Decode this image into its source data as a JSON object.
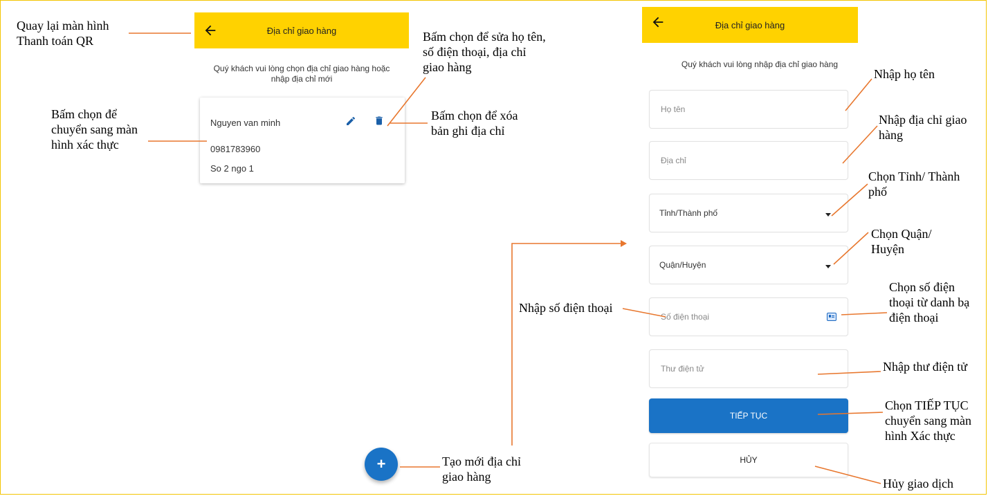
{
  "colors": {
    "header": "#ffd200",
    "primary": "#1a73c6",
    "annotation_line": "#e8772e"
  },
  "left_screen": {
    "header": {
      "title": "Địa chỉ giao hàng",
      "back_icon": "arrow-left-icon"
    },
    "subtitle": "Quý khách vui lòng chọn địa chỉ giao hàng hoặc\nnhập địa chỉ mới",
    "address_card": {
      "name": "Nguyen van minh",
      "phone": "0981783960",
      "address": "So 2 ngo 1",
      "edit_icon": "pencil-icon",
      "delete_icon": "trash-icon"
    },
    "fab": {
      "label": "+",
      "icon": "plus-icon"
    }
  },
  "right_screen": {
    "header": {
      "title": "Địa chỉ giao hàng",
      "back_icon": "arrow-left-icon"
    },
    "subtitle": "Quý khách vui lòng nhập địa chỉ giao hàng",
    "fields": {
      "name_placeholder": "Họ tên",
      "address_placeholder": "Địa chỉ",
      "province_label": "Tỉnh/Thành phố",
      "district_label": "Quận/Huyện",
      "phone_placeholder": "Số điện thoại",
      "email_placeholder": "Thư điện tử"
    },
    "continue_label": "TIẾP TỤC",
    "cancel_label": "HỦY"
  },
  "annotations": {
    "back": "Quay lại màn hình\nThanh toán QR",
    "edit": "Bấm chọn để sửa họ tên,\nsố điện thoại, địa chỉ\ngiao hàng",
    "select_card": "Bấm chọn để\nchuyển sang màn\nhình xác thực",
    "delete": "Bấm chọn để xóa\nbản ghi địa chỉ",
    "create_new": "Tạo mới địa chỉ\ngiao hàng",
    "input_name": "Nhập họ tên",
    "input_address": "Nhập địa chỉ giao\nhàng",
    "choose_province": "Chọn Tỉnh/ Thành\nphố",
    "choose_district": "Chọn Quận/\nHuyện",
    "input_phone": "Nhập số điện thoại",
    "phone_contacts": "Chọn số điện\nthoại từ danh bạ\nđiện thoại",
    "input_email": "Nhập thư điện tử",
    "continue": "Chọn TIẾP TỤC\nchuyển sang màn\nhình Xác thực",
    "cancel": "Hủy giao dịch"
  }
}
